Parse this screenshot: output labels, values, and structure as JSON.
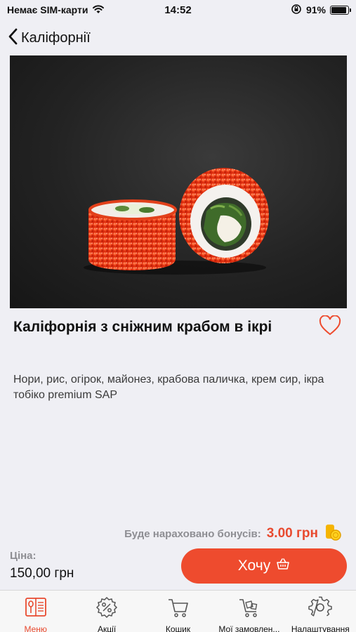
{
  "status_bar": {
    "carrier": "Немає SIM-карти",
    "time": "14:52",
    "battery_percent": "91%",
    "battery_level": 0.91
  },
  "nav": {
    "back_label": "Каліфорнії"
  },
  "product": {
    "title": "Каліфорнія з сніжним крабом в ікрі",
    "description": "Нори, рис, огірок, майонез, крабова паличка, крем сир, ікра тобіко premium SAP",
    "favorited": false
  },
  "bonus": {
    "label": "Буде нараховано бонусів:",
    "value": "3.00 грн"
  },
  "price": {
    "label": "Ціна:",
    "value": "150,00 грн"
  },
  "actions": {
    "want_label": "Хочу"
  },
  "tabs": [
    {
      "label": "Меню",
      "icon": "menu-book-icon",
      "active": true
    },
    {
      "label": "Акції",
      "icon": "discount-icon",
      "active": false
    },
    {
      "label": "Кошик",
      "icon": "cart-icon",
      "active": false
    },
    {
      "label": "Мої замовлен...",
      "icon": "orders-cart-icon",
      "active": false
    },
    {
      "label": "Налаштування",
      "icon": "gear-icon",
      "active": false
    }
  ],
  "colors": {
    "accent": "#ee4b2e",
    "background": "#efeff4",
    "muted_text": "#8e8e93"
  }
}
